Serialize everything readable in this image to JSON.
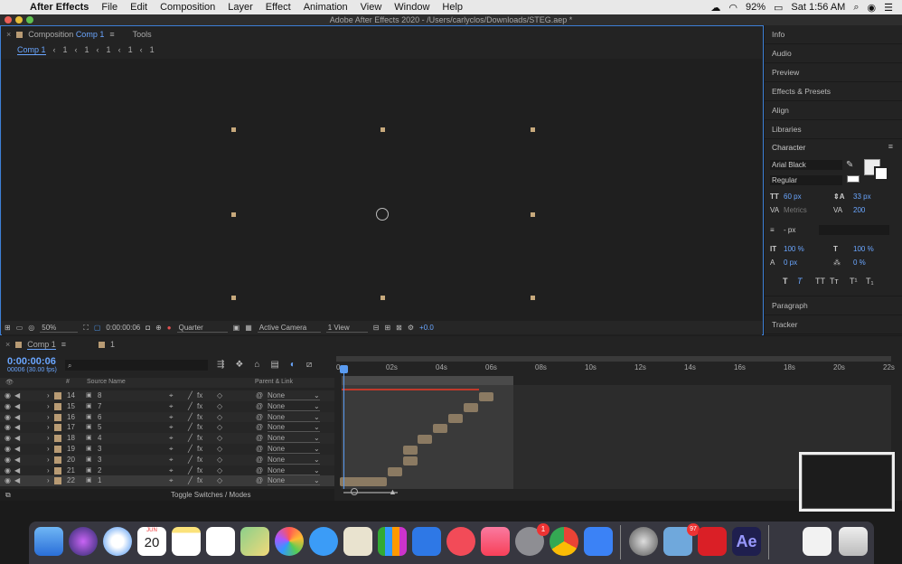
{
  "menubar": {
    "app_name": "After Effects",
    "items": [
      "File",
      "Edit",
      "Composition",
      "Layer",
      "Effect",
      "Animation",
      "View",
      "Window",
      "Help"
    ],
    "battery": "92%",
    "clock": "Sat 1:56 AM"
  },
  "window": {
    "title": "Adobe After Effects 2020 - /Users/carlyclos/Downloads/STEG.aep *"
  },
  "comp_panel": {
    "tab_label": "Composition",
    "tab_comp": "Comp 1",
    "tools_tab": "Tools",
    "breadcrumb": [
      "Comp 1",
      "1",
      "1",
      "1",
      "1",
      "1"
    ],
    "zoom": "50%",
    "timecode": "0:00:00:06",
    "resolution": "Quarter",
    "camera": "Active Camera",
    "views": "1 View",
    "exposure": "+0.0"
  },
  "right_panel": {
    "items_top": [
      "Info",
      "Audio",
      "Preview",
      "Effects & Presets",
      "Align",
      "Libraries"
    ],
    "character_title": "Character",
    "font_family": "Arial Black",
    "font_style": "Regular",
    "font_size": "60 px",
    "leading": "33 px",
    "kerning": "Metrics",
    "tracking": "200",
    "stroke_width": "- px",
    "vert_scale": "100 %",
    "horiz_scale": "100 %",
    "baseline_shift": "0 px",
    "tsume": "0 %",
    "items_bottom": [
      "Paragraph",
      "Tracker"
    ]
  },
  "timeline": {
    "tab_label": "Comp 1",
    "tab_other": "1",
    "current_time": "0:00:00:06",
    "fps_note": "00006 (30.00 fps)",
    "search_placeholder": "",
    "col_hash": "#",
    "col_source": "Source Name",
    "col_parent": "Parent & Link",
    "toggle_label": "Toggle Switches / Modes",
    "ruler": [
      "0s",
      "02s",
      "04s",
      "06s",
      "08s",
      "10s",
      "12s",
      "14s",
      "16s",
      "18s",
      "20s",
      "22s"
    ],
    "layers": [
      {
        "num": "14",
        "name": "8",
        "parent": "None"
      },
      {
        "num": "15",
        "name": "7",
        "parent": "None"
      },
      {
        "num": "16",
        "name": "6",
        "parent": "None"
      },
      {
        "num": "17",
        "name": "5",
        "parent": "None"
      },
      {
        "num": "18",
        "name": "4",
        "parent": "None"
      },
      {
        "num": "19",
        "name": "3",
        "parent": "None"
      },
      {
        "num": "20",
        "name": "3",
        "parent": "None"
      },
      {
        "num": "21",
        "name": "2",
        "parent": "None"
      },
      {
        "num": "22",
        "name": "1",
        "parent": "None"
      }
    ]
  },
  "dock": {
    "calendar_month": "JUN",
    "calendar_day": "20",
    "badge_settings": "1",
    "badge_mail": "97",
    "ae_label": "Ae"
  }
}
